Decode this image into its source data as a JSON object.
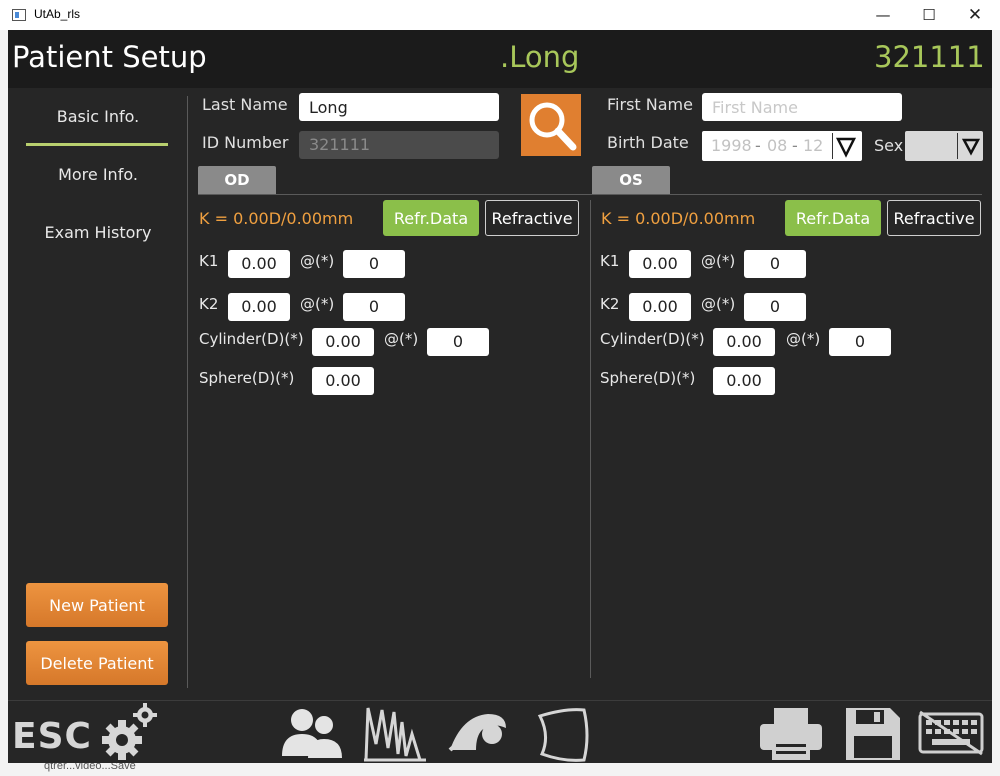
{
  "window": {
    "title": "UtAb_rls",
    "minimize": "—",
    "maximize": "☐",
    "close": "✕"
  },
  "background_text": "qtrer...video...Save",
  "header": {
    "title": "Patient Setup",
    "patient_name": ".Long",
    "patient_id": "321111"
  },
  "sidebar": {
    "items": [
      {
        "label": "Basic Info.",
        "active": true
      },
      {
        "label": "More Info.",
        "active": false
      },
      {
        "label": "Exam History",
        "active": false
      }
    ],
    "new_patient": "New Patient",
    "delete_patient": "Delete Patient"
  },
  "basic": {
    "last_name_label": "Last Name",
    "last_name_value": "Long",
    "id_number_label": "ID Number",
    "id_number_value": "321111",
    "first_name_label": "First Name",
    "first_name_placeholder": "First Name",
    "birth_date_label": "Birth Date",
    "birth_year": "1998",
    "birth_month": "08",
    "birth_day": "12",
    "date_sep": "-",
    "sex_label": "Sex",
    "sex_value": ""
  },
  "od": {
    "tab": "OD",
    "k_text": "K = 0.00D/0.00mm",
    "refr_data": "Refr.Data",
    "refractive": "Refractive",
    "k1_label": "K1",
    "k1": "0.00",
    "k1_axis_label": "@(*)",
    "k1_axis": "0",
    "k2_label": "K2",
    "k2": "0.00",
    "k2_axis_label": "@(*)",
    "k2_axis": "0",
    "cyl_label": "Cylinder(D)(*)",
    "cyl": "0.00",
    "cyl_axis_label": "@(*)",
    "cyl_axis": "0",
    "sph_label": "Sphere(D)(*)",
    "sph": "0.00"
  },
  "os": {
    "tab": "OS",
    "k_text": "K = 0.00D/0.00mm",
    "refr_data": "Refr.Data",
    "refractive": "Refractive",
    "k1_label": "K1",
    "k1": "0.00",
    "k1_axis_label": "@(*)",
    "k1_axis": "0",
    "k2_label": "K2",
    "k2": "0.00",
    "k2_axis_label": "@(*)",
    "k2_axis": "0",
    "cyl_label": "Cylinder(D)(*)",
    "cyl": "0.00",
    "cyl_axis_label": "@(*)",
    "cyl_axis": "0",
    "sph_label": "Sphere(D)(*)",
    "sph": "0.00"
  },
  "footer": {
    "esc": "ESC",
    "icons": [
      "gear-icon",
      "patients-icon",
      "waveform-icon",
      "eye-icon",
      "cornea-icon",
      "printer-icon",
      "save-icon",
      "keyboard-icon"
    ]
  },
  "colors": {
    "accent_green": "#a8c75a",
    "orange": "#e07f30",
    "k_orange": "#f0a040",
    "refr_green": "#8bbf4a",
    "bg": "#262626"
  }
}
